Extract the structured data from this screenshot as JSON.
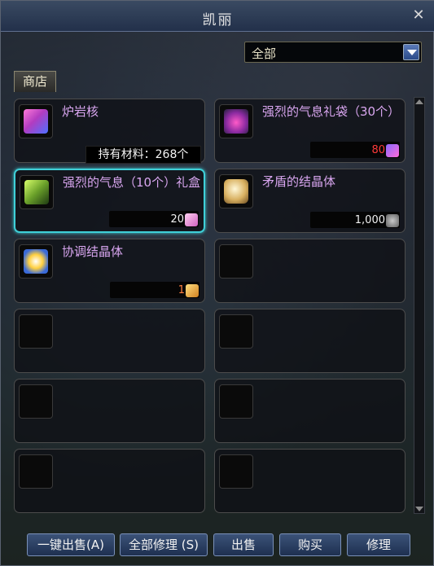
{
  "window": {
    "title": "凯丽"
  },
  "filter": {
    "selected": "全部"
  },
  "tabs": [
    {
      "label": "商店"
    }
  ],
  "tooltip": {
    "text": "持有材料：268个"
  },
  "items": [
    {
      "name": "炉岩核",
      "price": "",
      "icon": "lava-core-icon",
      "currency_icon": ""
    },
    {
      "name": "强烈的气息礼袋（30个）",
      "price": "80",
      "price_color": "#ff3a3a",
      "icon": "gift-bag-30-icon",
      "currency_icon": "gift-token-icon"
    },
    {
      "name": "强烈的气息（10个）礼盒",
      "price": "20",
      "price_color": "#f0f0f0",
      "icon": "gift-box-10-icon",
      "currency_icon": "pink-crystal-icon",
      "selected": true
    },
    {
      "name": "矛盾的结晶体",
      "price": "1,000",
      "price_color": "#f0f0f0",
      "icon": "contradiction-crystal-icon",
      "currency_icon": "silver-coin-icon"
    },
    {
      "name": "协调结晶体",
      "price": "1",
      "price_color": "#ff8040",
      "icon": "harmony-crystal-icon",
      "currency_icon": "gold-ore-icon"
    }
  ],
  "buttons": {
    "sell_all": "一键出售(A)",
    "repair_all": "全部修理 (S)",
    "sell": "出售",
    "buy": "购买",
    "repair": "修理"
  }
}
